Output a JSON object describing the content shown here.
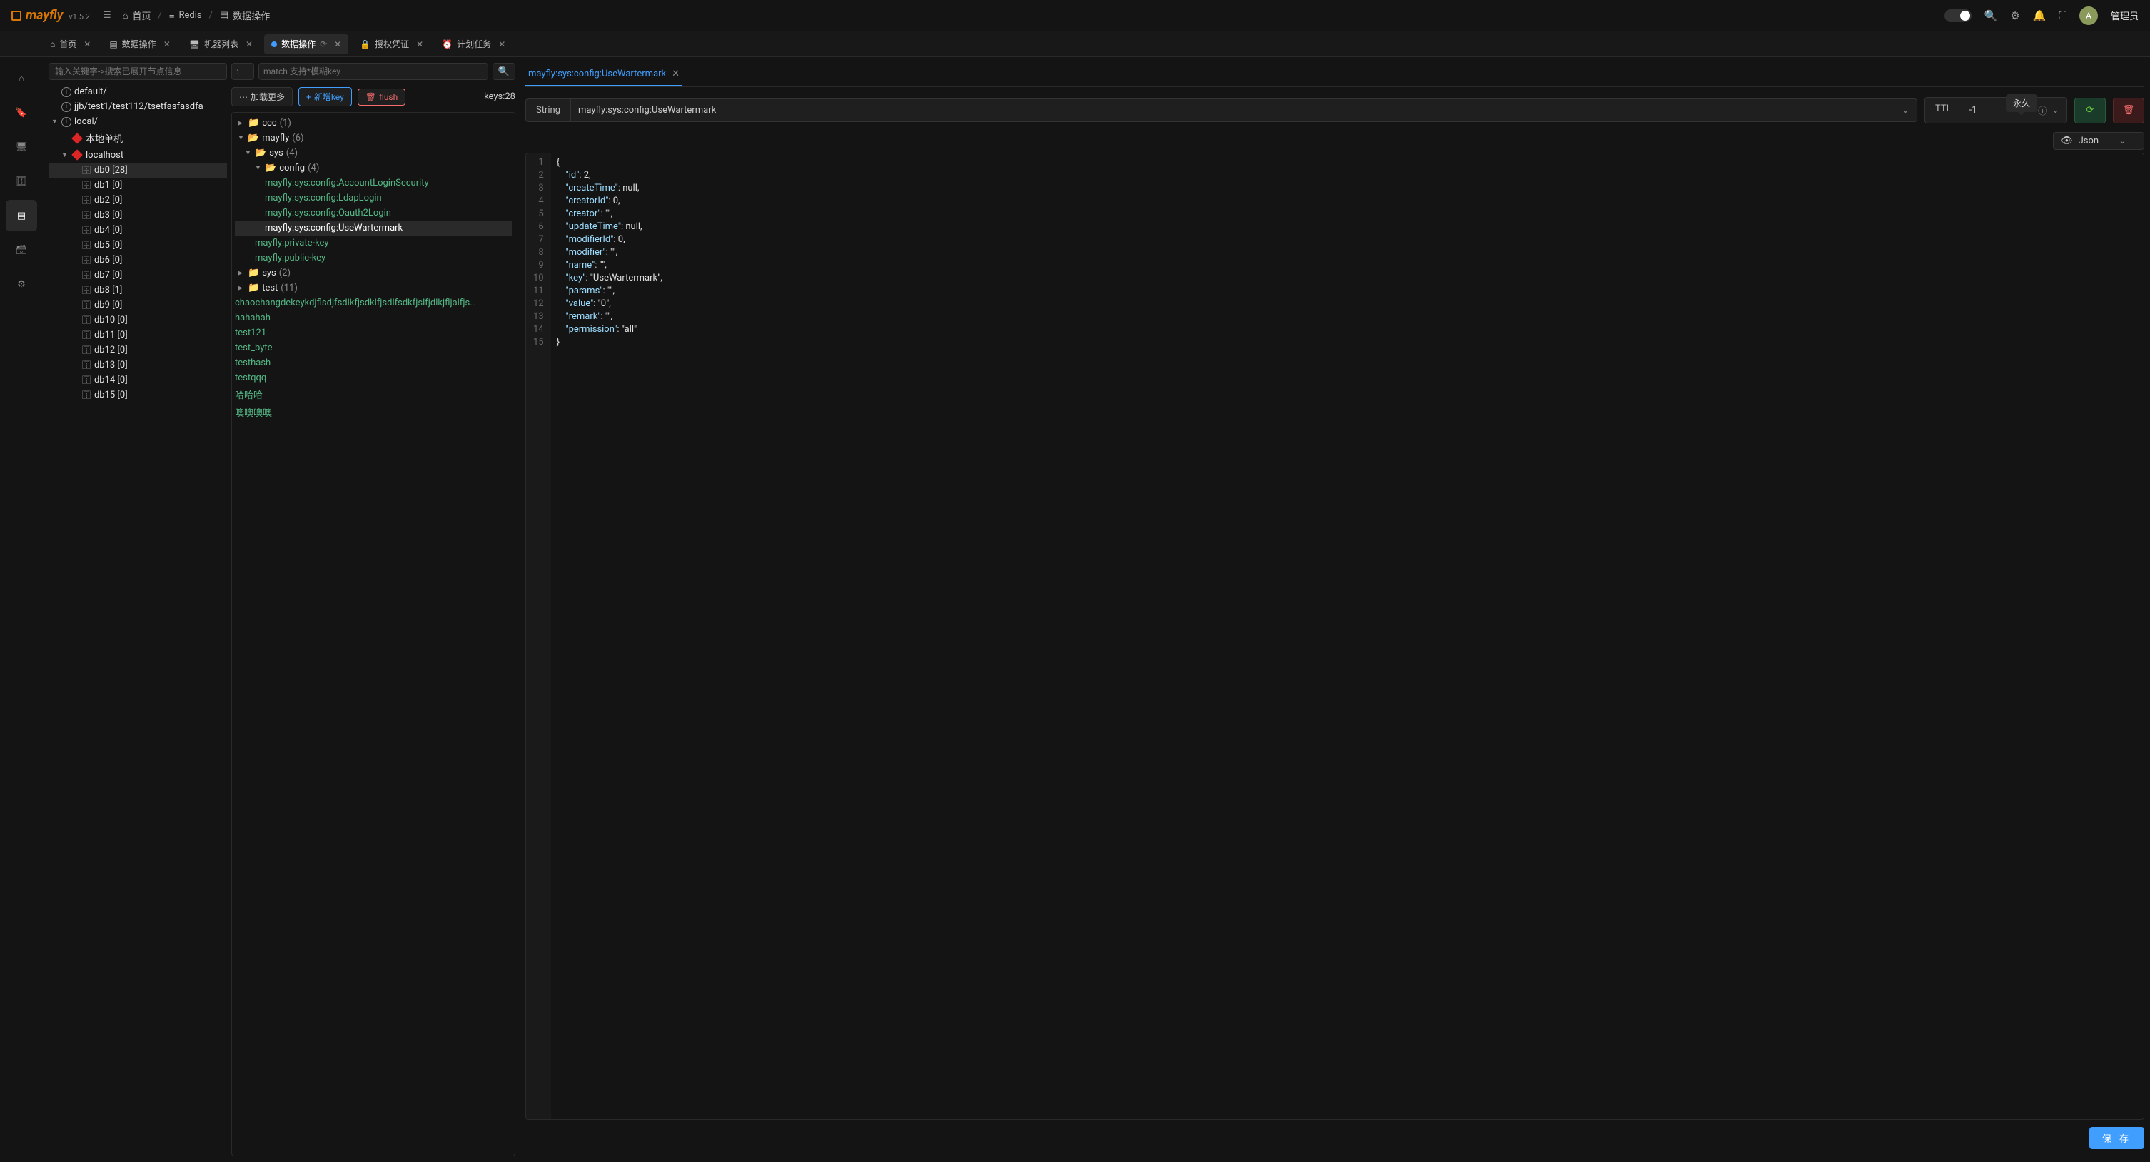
{
  "app": {
    "name": "mayfly",
    "version": "v1.5.2"
  },
  "breadcrumb": [
    {
      "label": "首页",
      "icon": "home"
    },
    {
      "label": "Redis",
      "icon": "layers"
    },
    {
      "label": "数据操作",
      "icon": "stack"
    }
  ],
  "user": {
    "name": "管理员",
    "initial": "A"
  },
  "tabs": [
    {
      "label": "首页",
      "icon": "home",
      "closable": true
    },
    {
      "label": "数据操作",
      "icon": "stack",
      "closable": true
    },
    {
      "label": "机器列表",
      "icon": "monitor",
      "closable": true
    },
    {
      "label": "数据操作",
      "icon": "dot",
      "closable": true,
      "active": true,
      "refresh": true
    },
    {
      "label": "授权凭证",
      "icon": "lock",
      "closable": true
    },
    {
      "label": "计划任务",
      "icon": "clock",
      "closable": true
    }
  ],
  "tree": {
    "search_placeholder": "输入关键字->搜索已展开节点信息",
    "nodes": [
      {
        "label": "default/",
        "type": "group"
      },
      {
        "label": "jjb/test1/test112/tsetfasfasdfa",
        "type": "group"
      },
      {
        "label": "local/",
        "type": "group",
        "open": true,
        "children": [
          {
            "label": "本地单机",
            "type": "redis"
          },
          {
            "label": "localhost",
            "type": "redis",
            "open": true,
            "children": [
              {
                "label": "db0 [28]",
                "sel": true
              },
              {
                "label": "db1 [0]"
              },
              {
                "label": "db2 [0]"
              },
              {
                "label": "db3 [0]"
              },
              {
                "label": "db4 [0]"
              },
              {
                "label": "db5 [0]"
              },
              {
                "label": "db6 [0]"
              },
              {
                "label": "db7 [0]"
              },
              {
                "label": "db8 [1]"
              },
              {
                "label": "db9 [0]"
              },
              {
                "label": "db10 [0]"
              },
              {
                "label": "db11 [0]"
              },
              {
                "label": "db12 [0]"
              },
              {
                "label": "db13 [0]"
              },
              {
                "label": "db14 [0]"
              },
              {
                "label": "db15 [0]"
              }
            ]
          }
        ]
      }
    ]
  },
  "keys": {
    "colon_value": "",
    "colon_placeholder": ":",
    "match_placeholder": "match 支持*模糊key",
    "load_more": "加载更多",
    "new_key": "新增key",
    "flush": "flush",
    "count_label": "keys:28",
    "tree": [
      {
        "label": "ccc",
        "count": "(1)",
        "open": false
      },
      {
        "label": "mayfly",
        "count": "(6)",
        "open": true,
        "children": [
          {
            "label": "sys",
            "count": "(4)",
            "open": true,
            "children": [
              {
                "label": "config",
                "count": "(4)",
                "open": true,
                "children": [
                  {
                    "leaf": "mayfly:sys:config:AccountLoginSecurity"
                  },
                  {
                    "leaf": "mayfly:sys:config:LdapLogin"
                  },
                  {
                    "leaf": "mayfly:sys:config:Oauth2Login"
                  },
                  {
                    "leaf": "mayfly:sys:config:UseWartermark",
                    "sel": true
                  }
                ]
              }
            ]
          },
          {
            "leaf": "mayfly:private-key",
            "indent": 2
          },
          {
            "leaf": "mayfly:public-key",
            "indent": 2
          }
        ]
      },
      {
        "label": "sys",
        "count": "(2)",
        "open": false
      },
      {
        "label": "test",
        "count": "(11)",
        "open": false
      },
      {
        "leaf": "chaochangdekeykdjflsdjfsdlkfjsdklfjsdlfsdkfjslfjdlkjfljalfjs…"
      },
      {
        "leaf": "hahahah"
      },
      {
        "leaf": "test121"
      },
      {
        "leaf": "test_byte"
      },
      {
        "leaf": "testhash"
      },
      {
        "leaf": "testqqq"
      },
      {
        "leaf": "哈哈哈"
      },
      {
        "leaf": "噢噢噢噢"
      }
    ]
  },
  "detail": {
    "tab_label": "mayfly:sys:config:UseWartermark",
    "type_label": "String",
    "key_value": "mayfly:sys:config:UseWartermark",
    "ttl_label": "TTL",
    "ttl_value": "-1",
    "ttl_tooltip": "永久",
    "format": "Json",
    "save": "保 存",
    "code": [
      {
        "n": 1,
        "t": "{"
      },
      {
        "n": 2,
        "t": "    \"id\": 2,"
      },
      {
        "n": 3,
        "t": "    \"createTime\": null,"
      },
      {
        "n": 4,
        "t": "    \"creatorId\": 0,"
      },
      {
        "n": 5,
        "t": "    \"creator\": \"\","
      },
      {
        "n": 6,
        "t": "    \"updateTime\": null,"
      },
      {
        "n": 7,
        "t": "    \"modifierId\": 0,"
      },
      {
        "n": 8,
        "t": "    \"modifier\": \"\","
      },
      {
        "n": 9,
        "t": "    \"name\": \"\","
      },
      {
        "n": 10,
        "t": "    \"key\": \"UseWartermark\","
      },
      {
        "n": 11,
        "t": "    \"params\": \"\","
      },
      {
        "n": 12,
        "t": "    \"value\": \"0\","
      },
      {
        "n": 13,
        "t": "    \"remark\": \"\","
      },
      {
        "n": 14,
        "t": "    \"permission\": \"all\""
      },
      {
        "n": 15,
        "t": "}"
      }
    ]
  }
}
